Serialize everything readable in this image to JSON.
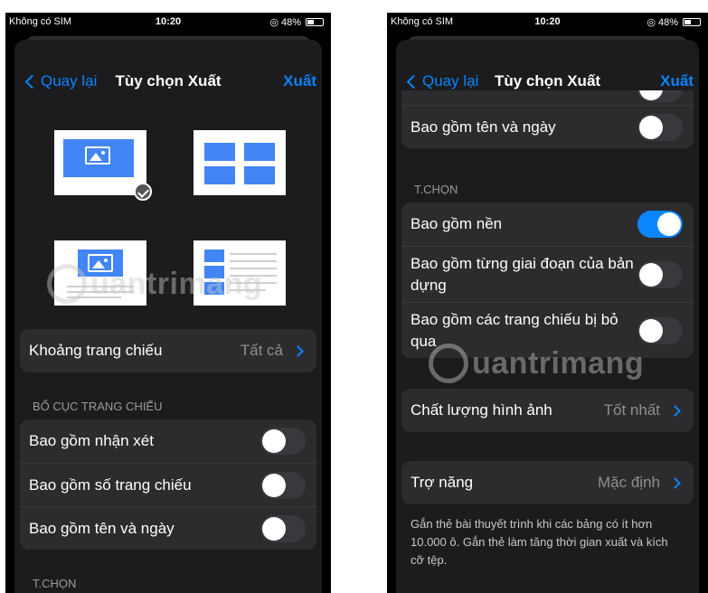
{
  "status": {
    "carrier": "Không có SIM",
    "time": "10:20",
    "battery": "48%"
  },
  "nav": {
    "back": "Quay lại",
    "title": "Tùy chọn Xuất",
    "action": "Xuất"
  },
  "left": {
    "slide_range": {
      "label": "Khoảng trang chiếu",
      "value": "Tất cả"
    },
    "section_layout": "BỐ CỤC TRANG CHIẾU",
    "toggles": [
      {
        "label": "Bao gồm nhận xét",
        "on": false
      },
      {
        "label": "Bao gồm số trang chiếu",
        "on": false
      },
      {
        "label": "Bao gồm tên và ngày",
        "on": false
      }
    ],
    "section_options": "T.CHỌN"
  },
  "right": {
    "top_row": {
      "label": "Bao gồm tên và ngày",
      "on": false
    },
    "section_options": "T.CHỌN",
    "toggles": [
      {
        "label": "Bao gồm nền",
        "on": true
      },
      {
        "label": "Bao gồm từng giai đoạn của bản dựng",
        "on": false
      },
      {
        "label": "Bao gồm các trang chiếu bị bỏ qua",
        "on": false
      }
    ],
    "image_quality": {
      "label": "Chất lượng hình ảnh",
      "value": "Tốt nhất"
    },
    "accessibility": {
      "label": "Trợ năng",
      "value": "Mặc định"
    },
    "footnote": "Gắn thẻ bài thuyết trình khi các bảng có ít hơn 10.000 ô. Gắn thẻ làm tăng thời gian xuất và kích cỡ tệp."
  },
  "watermark": "uantrimang",
  "colors": {
    "accent": "#0a84ff",
    "background": "#1c1c1e",
    "cell": "#2c2c2e"
  }
}
